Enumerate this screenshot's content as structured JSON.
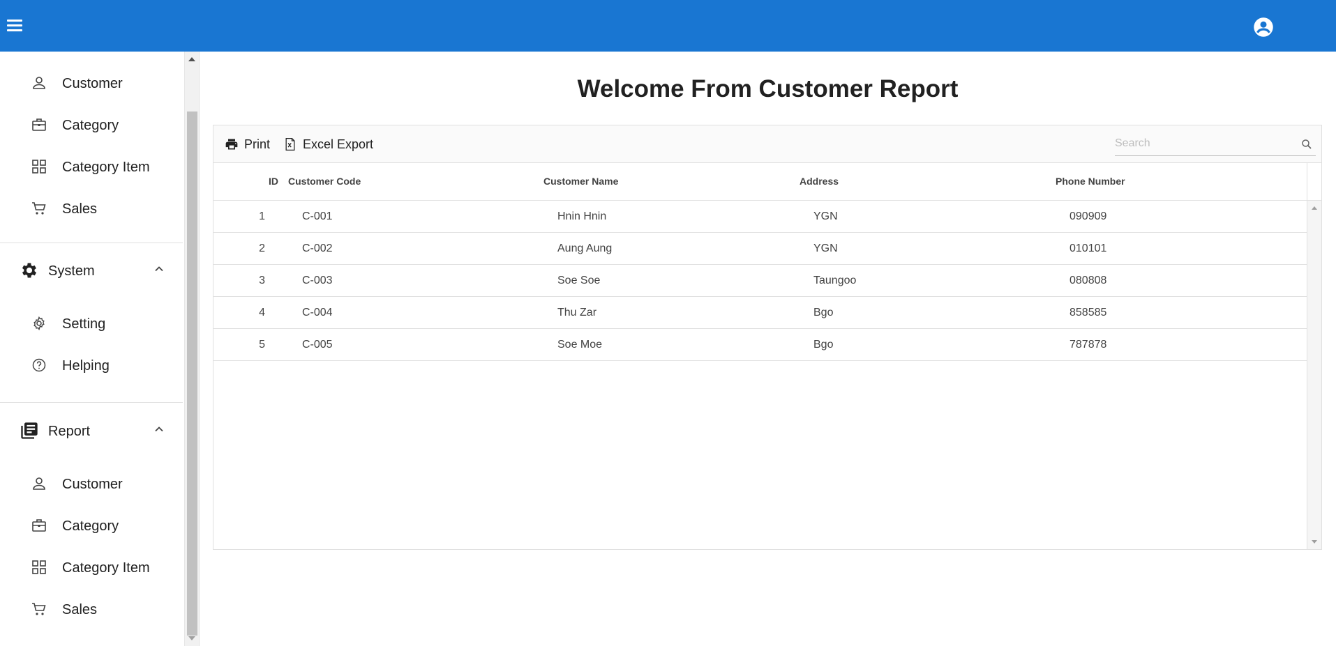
{
  "appbar": {
    "menu_icon": "menu-icon",
    "account_icon": "account-circle-icon",
    "color": "#1976d2"
  },
  "sidebar": {
    "top_items": [
      {
        "label": "Customer",
        "icon": "person-icon"
      },
      {
        "label": "Category",
        "icon": "briefcase-icon"
      },
      {
        "label": "Category Item",
        "icon": "grid-icon"
      },
      {
        "label": "Sales",
        "icon": "cart-icon"
      }
    ],
    "system": {
      "label": "System",
      "icon": "gear-icon",
      "items": [
        {
          "label": "Setting",
          "icon": "gear-outline-icon"
        },
        {
          "label": "Helping",
          "icon": "help-circle-icon"
        }
      ]
    },
    "report": {
      "label": "Report",
      "icon": "report-icon",
      "items": [
        {
          "label": "Customer",
          "icon": "person-icon"
        },
        {
          "label": "Category",
          "icon": "briefcase-icon"
        },
        {
          "label": "Category Item",
          "icon": "grid-icon"
        },
        {
          "label": "Sales",
          "icon": "cart-icon"
        }
      ]
    }
  },
  "main": {
    "title": "Welcome From Customer Report",
    "toolbar": {
      "print_label": "Print",
      "excel_label": "Excel Export"
    },
    "search": {
      "placeholder": "Search",
      "value": ""
    },
    "columns": [
      "ID",
      "Customer Code",
      "Customer Name",
      "Address",
      "Phone Number"
    ],
    "rows": [
      [
        "1",
        "C-001",
        "Hnin Hnin",
        "YGN",
        "090909"
      ],
      [
        "2",
        "C-002",
        "Aung Aung",
        "YGN",
        "010101"
      ],
      [
        "3",
        "C-003",
        "Soe Soe",
        "Taungoo",
        "080808"
      ],
      [
        "4",
        "C-004",
        "Thu Zar",
        "Bgo",
        "858585"
      ],
      [
        "5",
        "C-005",
        "Soe Moe",
        "Bgo",
        "787878"
      ]
    ]
  }
}
